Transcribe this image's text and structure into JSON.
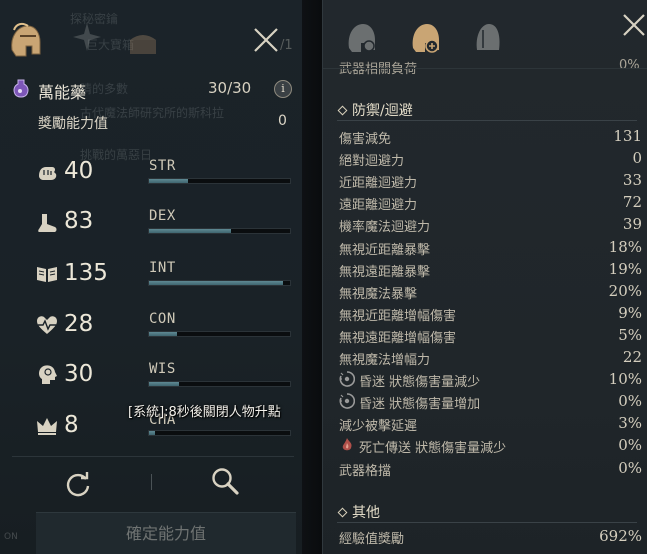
{
  "left": {
    "ghost_texts": [
      "秘",
      "探秘密鑰",
      "巨大寶箱",
      "睛的多數",
      "古代魔法師研究所的斯科拉",
      "挑戰的萬惡日"
    ],
    "ghost_count": "/1",
    "potion": {
      "name": "萬能藥",
      "value": "30/30",
      "info_glyph": "i"
    },
    "bonus": {
      "label": "獎勵能力值",
      "value": "0"
    },
    "stats": [
      {
        "key": "str",
        "value": "40",
        "name": "STR",
        "fill": 0.28,
        "icon": "fist-icon"
      },
      {
        "key": "dex",
        "value": "83",
        "name": "DEX",
        "fill": 0.58,
        "icon": "boot-icon"
      },
      {
        "key": "int",
        "value": "135",
        "name": "INT",
        "fill": 0.95,
        "icon": "book-icon"
      },
      {
        "key": "con",
        "value": "28",
        "name": "CON",
        "fill": 0.2,
        "icon": "heartbeat-icon"
      },
      {
        "key": "wis",
        "value": "30",
        "name": "WIS",
        "fill": 0.21,
        "icon": "head-icon"
      },
      {
        "key": "cha",
        "value": "8",
        "name": "CHA",
        "fill": 0.04,
        "icon": "crown-icon"
      }
    ],
    "system_message": "[系統]:8秒後關閉人物升點",
    "confirm_label": "確定能力值",
    "on_label": "ON"
  },
  "right": {
    "cut_label": "武器相關負荷",
    "cut_value": "0%",
    "defense_title": "防禦/迴避",
    "defense_rows": [
      {
        "label": "傷害減免",
        "value": "131"
      },
      {
        "label": "絕對迴避力",
        "value": "0"
      },
      {
        "label": "近距離迴避力",
        "value": "33"
      },
      {
        "label": "遠距離迴避力",
        "value": "72"
      },
      {
        "label": "機率魔法迴避力",
        "value": "39"
      },
      {
        "label": "無視近距離暴擊",
        "value": "18%"
      },
      {
        "label": "無視遠距離暴擊",
        "value": "19%"
      },
      {
        "label": "無視魔法暴擊",
        "value": "20%"
      },
      {
        "label": "無視近距離增幅傷害",
        "value": "9%"
      },
      {
        "label": "無視遠距離增幅傷害",
        "value": "5%"
      },
      {
        "label": "無視魔法增幅力",
        "value": "22"
      },
      {
        "label": "昏迷 狀態傷害量減少",
        "value": "10%",
        "icon": "stun-icon"
      },
      {
        "label": "昏迷 狀態傷害量增加",
        "value": "0%",
        "icon": "stun-icon"
      },
      {
        "label": "減少被擊延遲",
        "value": "3%"
      },
      {
        "label": "死亡傳送 狀態傷害量減少",
        "value": "0%",
        "icon": "death-icon"
      },
      {
        "label": "武器格擋",
        "value": "0%"
      }
    ],
    "other_title": "其他",
    "other_rows": [
      {
        "label": "經驗值獎勵",
        "value": "692%"
      }
    ]
  },
  "colors": {
    "gold": "#c9a574",
    "bar_fill": "#4f7a84",
    "panel_bg": "#1b2329"
  }
}
